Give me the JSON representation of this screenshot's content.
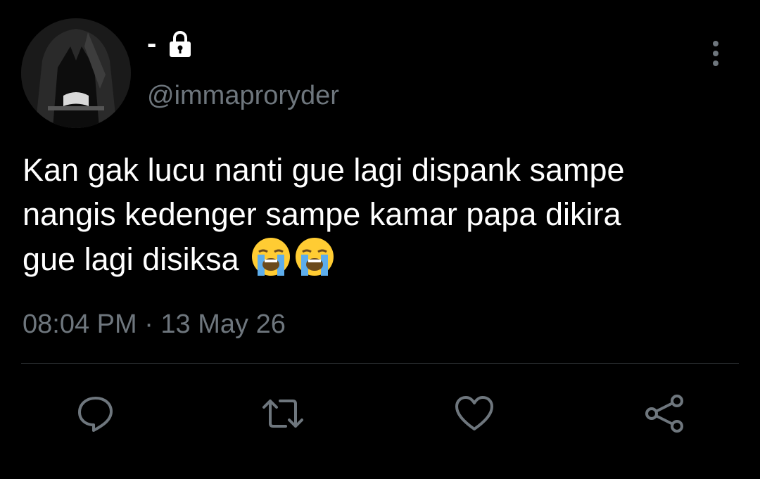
{
  "tweet": {
    "display_name": "-",
    "handle": "@immaproryder",
    "text_lines": [
      "Kan gak lucu nanti gue lagi dispank sampe",
      "nangis kedenger sampe kamar papa dikira",
      "gue lagi disiksa "
    ],
    "emoji": [
      "😭",
      "😭"
    ],
    "timestamp": "08:04 PM · 13 May 26"
  },
  "icons": {
    "lock": "lock-icon",
    "more": "more-vertical-icon",
    "reply": "reply-icon",
    "retweet": "retweet-icon",
    "like": "heart-icon",
    "share": "share-icon"
  },
  "colors": {
    "background": "#000000",
    "text": "#ffffff",
    "secondary": "#6e767d",
    "divider": "#2f3336",
    "icon": "#6e767d"
  }
}
